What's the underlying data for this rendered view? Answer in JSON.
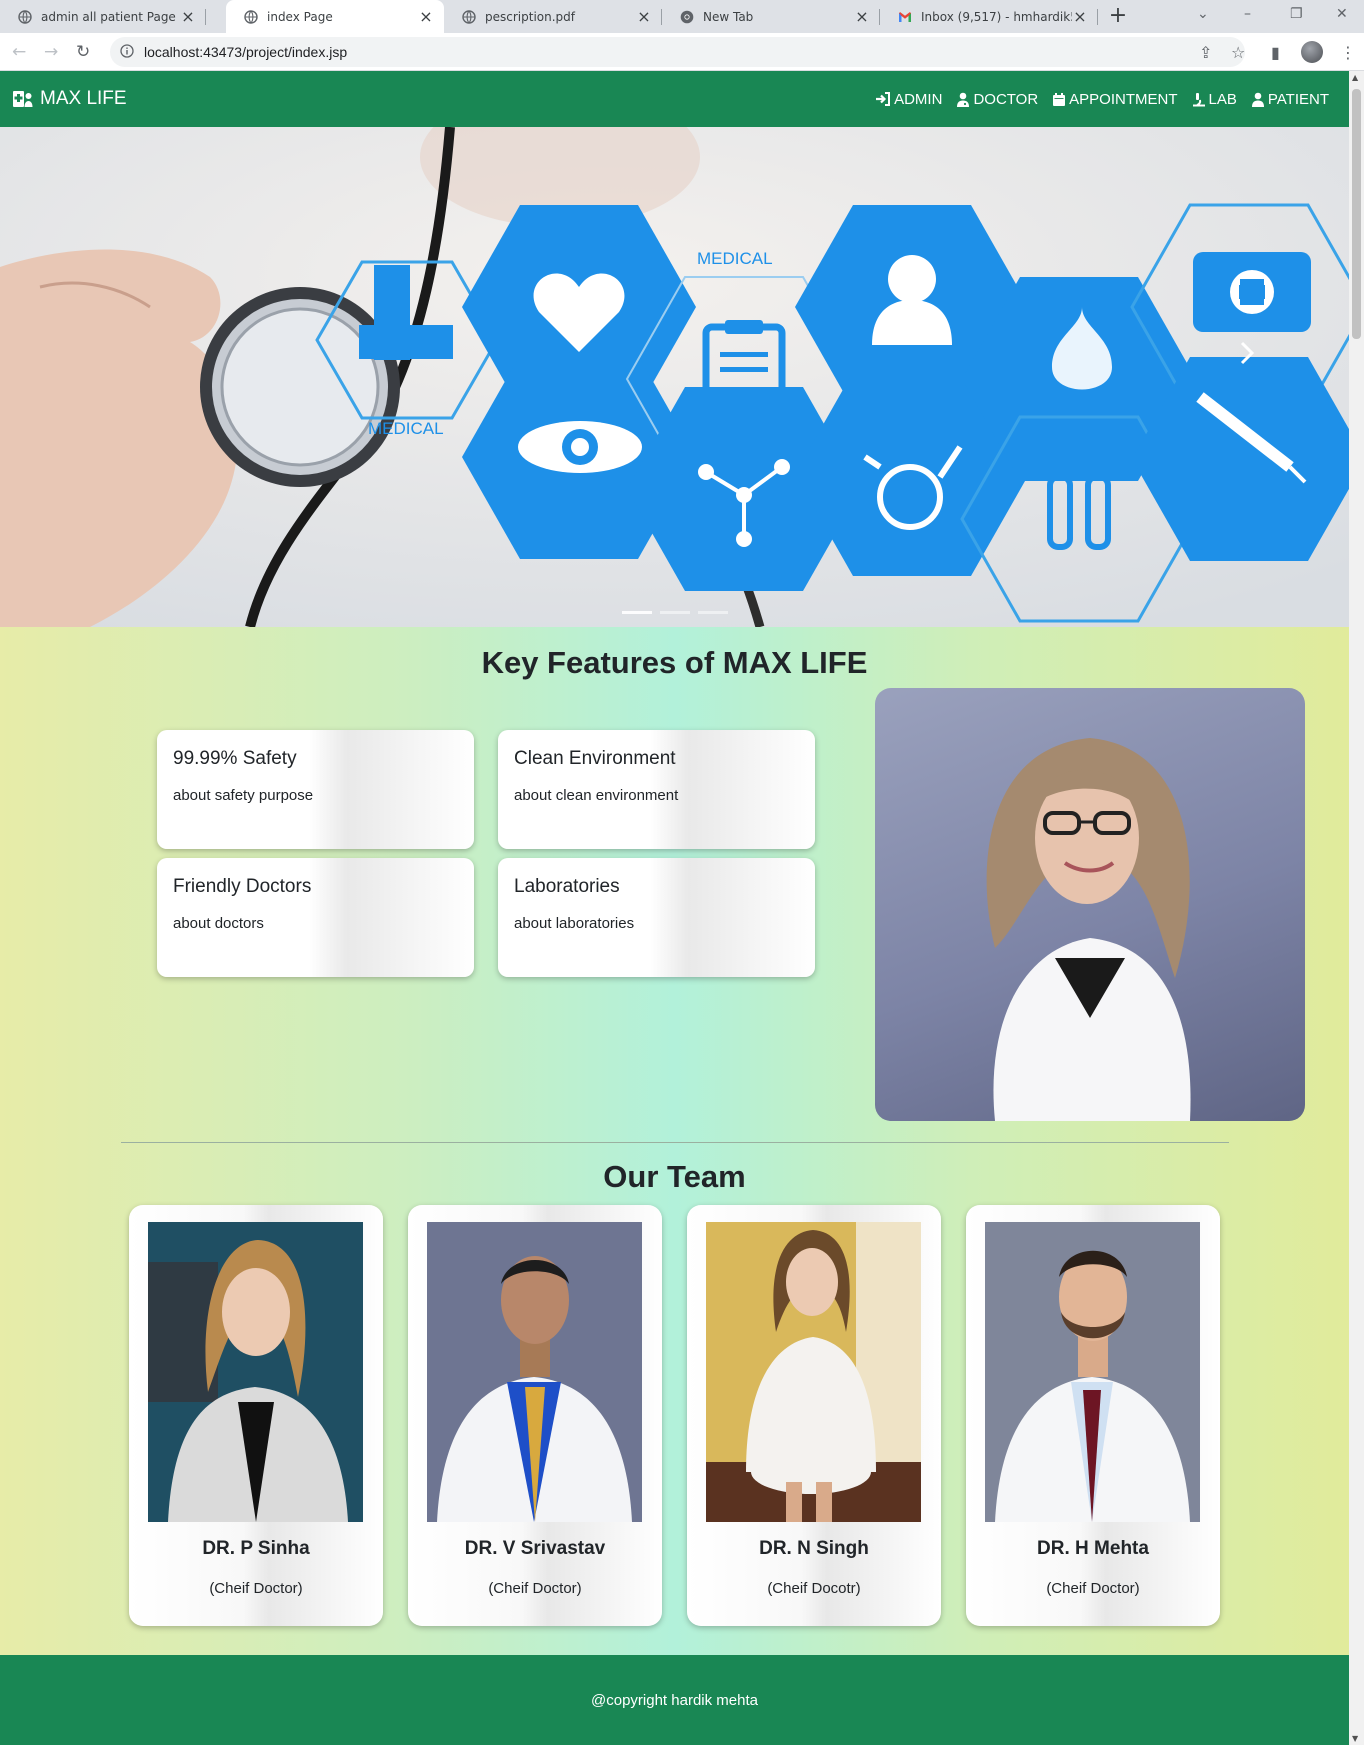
{
  "browser": {
    "tabs": [
      {
        "title": "admin all patient Page",
        "icon": "globe-icon",
        "active": false
      },
      {
        "title": "index Page",
        "icon": "globe-icon",
        "active": true
      },
      {
        "title": "pescription.pdf",
        "icon": "globe-icon",
        "active": false
      },
      {
        "title": "New Tab",
        "icon": "chrome-icon",
        "active": false
      },
      {
        "title": "Inbox (9,517) - hmhardik502",
        "icon": "gmail-icon",
        "active": false
      }
    ],
    "url": "localhost:43473/project/index.jsp"
  },
  "navbar": {
    "brand": "MAX LIFE",
    "items": [
      {
        "label": "ADMIN",
        "icon": "sign-in-icon"
      },
      {
        "label": "DOCTOR",
        "icon": "user-doctor-icon"
      },
      {
        "label": "APPOINTMENT",
        "icon": "calendar-icon"
      },
      {
        "label": "LAB",
        "icon": "microscope-icon"
      },
      {
        "label": "PATIENT",
        "icon": "user-icon"
      }
    ],
    "color": "#198754"
  },
  "hero": {
    "labels": [
      "MEDICAL",
      "MEDICAL"
    ]
  },
  "features": {
    "title": "Key Features of MAX LIFE",
    "cards": [
      {
        "heading": "99.99% Safety",
        "text": "about safety purpose"
      },
      {
        "heading": "Clean Environment",
        "text": "about clean environment"
      },
      {
        "heading": "Friendly Doctors",
        "text": "about doctors"
      },
      {
        "heading": "Laboratories",
        "text": "about laboratories"
      }
    ]
  },
  "team": {
    "title": "Our Team",
    "members": [
      {
        "name": "DR. P Sinha",
        "role": "(Cheif Doctor)"
      },
      {
        "name": "DR. V Srivastav",
        "role": "(Cheif Doctor)"
      },
      {
        "name": "DR. N Singh",
        "role": "(Cheif Docotr)"
      },
      {
        "name": "DR. H Mehta",
        "role": "(Cheif Doctor)"
      }
    ]
  },
  "footer": {
    "text": "@copyright hardik mehta"
  }
}
